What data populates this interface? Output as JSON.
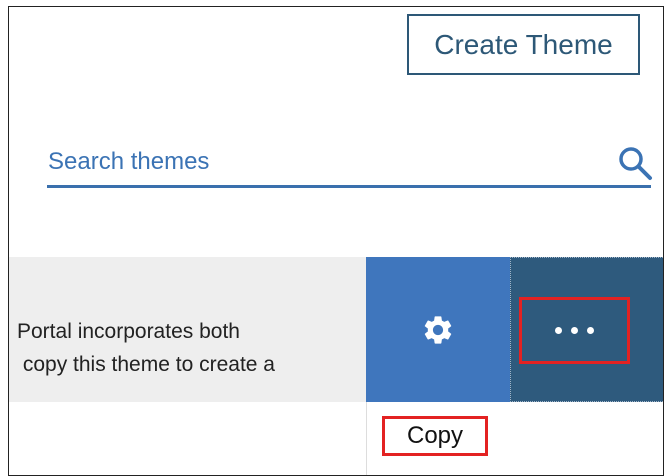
{
  "header": {
    "create_theme_label": "Create Theme"
  },
  "search": {
    "placeholder": "Search themes",
    "value": ""
  },
  "theme": {
    "description": "Portal incorporates both\n copy this theme to create a"
  },
  "menu": {
    "copy_label": "Copy"
  },
  "colors": {
    "accent_blue": "#3f76bd",
    "dark_blue": "#2e5a7d",
    "highlight_red": "#e32222",
    "link_blue": "#3b73b4"
  },
  "icons": {
    "search": "search-icon",
    "settings": "gear-icon",
    "more": "more-horizontal-icon"
  }
}
